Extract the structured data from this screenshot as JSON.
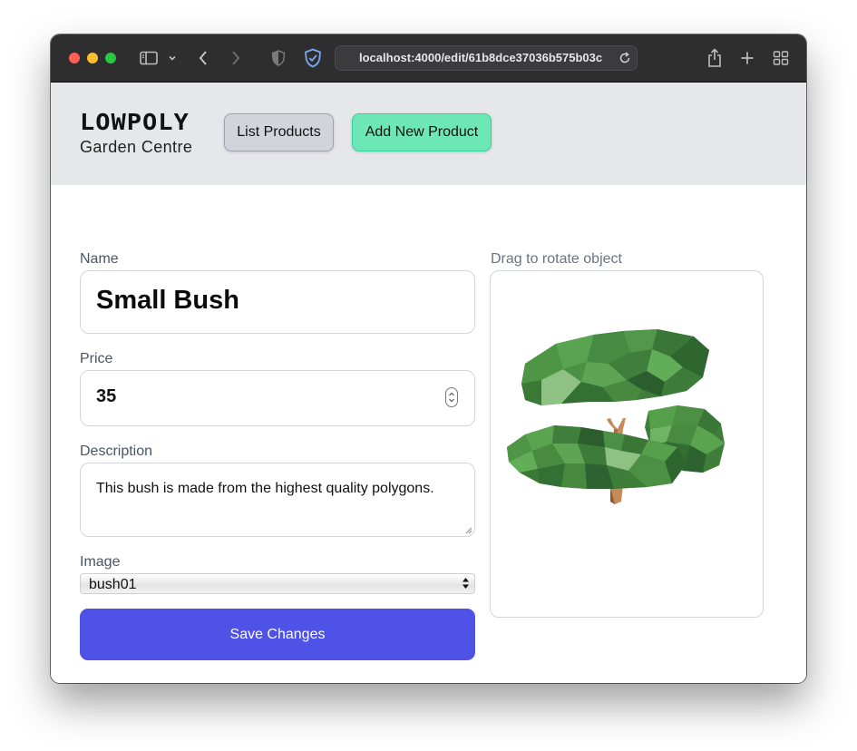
{
  "browser": {
    "url": "localhost:4000/edit/61b8dce37036b575b03c"
  },
  "header": {
    "logo_title": "LOWPOLY",
    "logo_subtitle": "Garden Centre",
    "list_products_label": "List Products",
    "add_product_label": "Add New Product"
  },
  "form": {
    "name_label": "Name",
    "name_value": "Small Bush",
    "price_label": "Price",
    "price_value": "35",
    "description_label": "Description",
    "description_value": "This bush is made from the highest quality polygons.",
    "image_label": "Image",
    "image_selected": "bush01",
    "save_label": "Save Changes"
  },
  "viewer": {
    "label": "Drag to rotate object"
  },
  "icons": {
    "sidebar": "sidebar-icon",
    "back": "chevron-left-icon",
    "forward": "chevron-right-icon",
    "privacy": "shield-icon",
    "reload": "reload-icon",
    "share": "share-icon",
    "new_tab": "plus-icon",
    "tabs": "tab-overview-icon"
  },
  "colors": {
    "header_bg": "#e5e7eb",
    "list_button": "#d1d5db",
    "add_button": "#6ee7b7",
    "save_button": "#4f52e6"
  }
}
